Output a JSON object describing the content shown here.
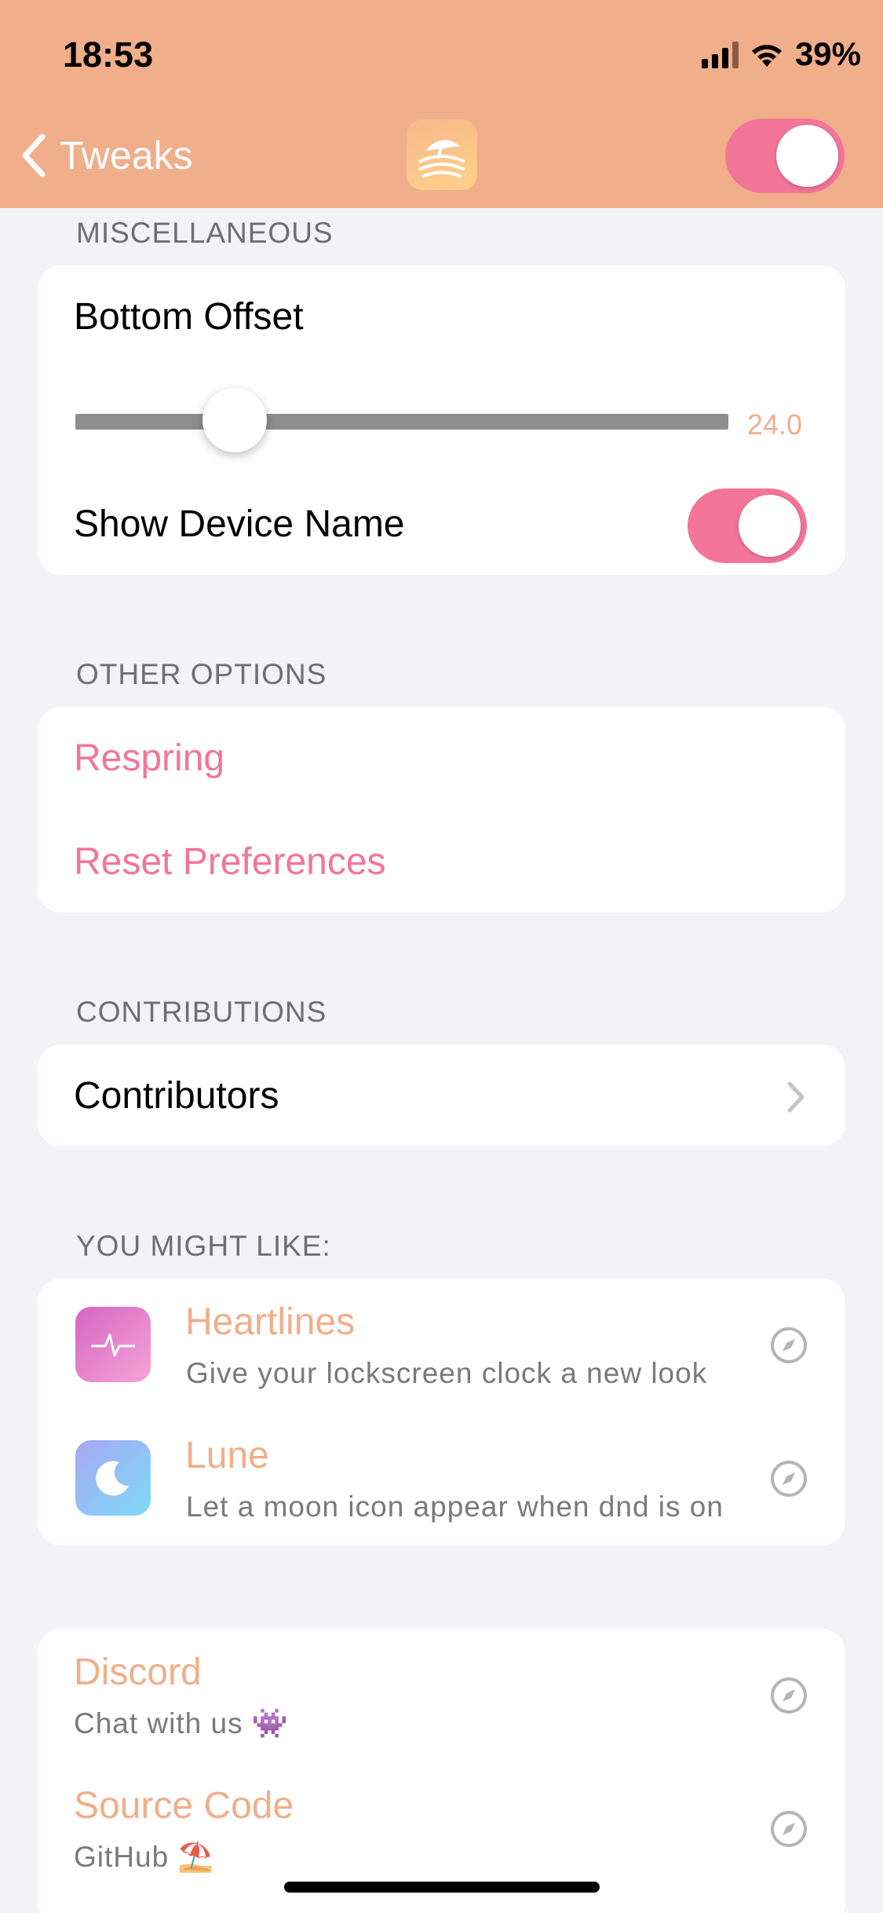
{
  "status_bar": {
    "time": "18:53",
    "battery": "39%"
  },
  "nav": {
    "back_label": "Tweaks",
    "enabled": true
  },
  "sections": {
    "misc": {
      "title": "MISCELLANEOUS",
      "bottom_offset_label": "Bottom Offset",
      "bottom_offset_value": "24.0",
      "show_device_name_label": "Show Device Name",
      "show_device_name_enabled": true
    },
    "other": {
      "title": "OTHER OPTIONS",
      "respring_label": "Respring",
      "reset_label": "Reset Preferences"
    },
    "contributions": {
      "title": "CONTRIBUTIONS",
      "contributors_label": "Contributors"
    },
    "you_might_like": {
      "title": "YOU MIGHT LIKE:",
      "items": [
        {
          "name": "Heartlines",
          "subtitle": "Give your lockscreen clock a new look"
        },
        {
          "name": "Lune",
          "subtitle": "Let a moon icon appear when dnd is on"
        }
      ]
    },
    "links": {
      "items": [
        {
          "name": "Discord",
          "subtitle": "Chat with us 👾"
        },
        {
          "name": "Source Code",
          "subtitle": "GitHub ⛱️"
        }
      ]
    }
  },
  "colors": {
    "header_bg": "#f0ae8b",
    "accent_pink": "#f3759a",
    "accent_orange": "#f0ae8b",
    "background": "#f2f2f7"
  },
  "icons": {
    "back": "chevron-left-icon",
    "app": "beach-umbrella-icon",
    "disclosure": "chevron-right-icon",
    "link": "compass-icon",
    "heartlines": "heartbeat-icon",
    "lune": "moon-icon"
  }
}
